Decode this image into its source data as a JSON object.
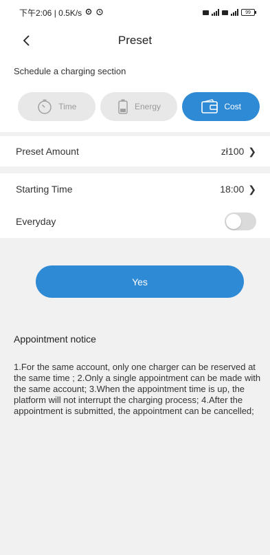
{
  "status_bar": {
    "left": "下午2:06 | 0.5K/s",
    "battery": "99"
  },
  "header": {
    "title": "Preset"
  },
  "schedule": {
    "label": "Schedule a charging section",
    "modes": [
      {
        "label": "Time",
        "icon": "timer-icon",
        "active": false
      },
      {
        "label": "Energy",
        "icon": "battery-icon",
        "active": false
      },
      {
        "label": "Cost",
        "icon": "wallet-icon",
        "active": true
      }
    ]
  },
  "preset_amount": {
    "label": "Preset Amount",
    "value": "zł100"
  },
  "starting_time": {
    "label": "Starting Time",
    "value": "18:00"
  },
  "everyday": {
    "label": "Everyday",
    "enabled": false
  },
  "confirm": {
    "label": "Yes"
  },
  "notice": {
    "title": "Appointment notice",
    "body": "1.For the same account, only one charger can be reserved at the same time ; 2.Only a single appointment can be made with the same account; 3.When the appointment time is up, the platform will not interrupt the charging process; 4.After the appointment is submitted, the appointment can be cancelled;"
  },
  "colors": {
    "accent": "#2f8ad6",
    "background": "#f1f1f1",
    "inactive_chip": "#e8e8e8"
  }
}
